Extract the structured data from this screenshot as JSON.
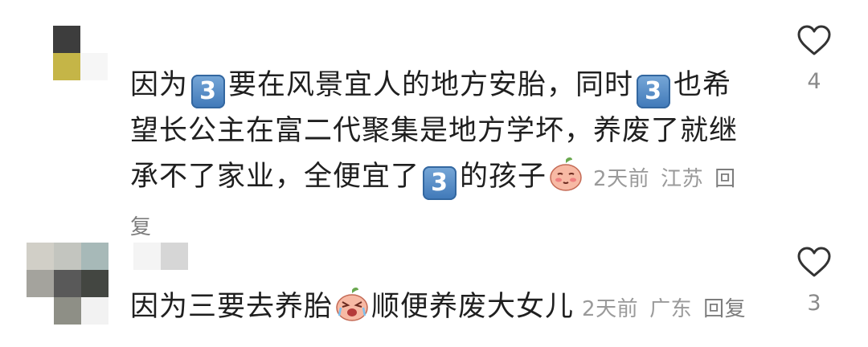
{
  "comments": [
    {
      "text_parts": [
        "因为",
        "要在风景宜人的地方安胎，同时",
        "也希望长公主在富二代聚集是地方学坏，养废了就继承不了家业，全便宜了",
        "的孩子"
      ],
      "number_emoji": "3",
      "time": "2天前",
      "location": "江苏",
      "reply_label": "回复",
      "like_count": "4",
      "emoji_names": [
        "keycap-3-icon",
        "blushing-peach-face-icon"
      ]
    },
    {
      "text_parts": [
        "因为三要去养胎",
        "顺便养废大女儿"
      ],
      "time": "2天前",
      "location": "广东",
      "reply_label": "回复",
      "like_count": "3",
      "emoji_names": [
        "crying-peach-face-icon"
      ]
    }
  ],
  "colors": {
    "text": "#1f1f1f",
    "meta": "#9a9a9a",
    "keycap": "#4a80c0",
    "heart_outline": "#333333"
  }
}
